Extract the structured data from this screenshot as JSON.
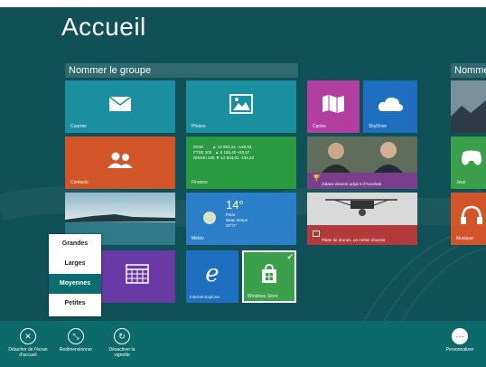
{
  "start": {
    "title": "Accueil"
  },
  "groups": [
    {
      "name": "Nommer le groupe"
    },
    {
      "name": "Nomme"
    }
  ],
  "tiles": {
    "mail": {
      "label": "Courrier"
    },
    "photos": {
      "label": "Photos"
    },
    "contacts": {
      "label": "Contacts"
    },
    "finance": {
      "label": "Finance",
      "rows": [
        "DOW        ▲ 14 993,14 +149,83",
        "FTSE 100   ▲ 6 165,40 +63,57",
        "NIKKEI 225 ▼ 12 834,01 -135,33"
      ]
    },
    "desktop": {
      "label": ""
    },
    "weather": {
      "label": "Météo",
      "temp": "14°",
      "city": "Paris",
      "cond": "Beau temps",
      "range": "20°/7°"
    },
    "ie": {
      "label": "Internet Explorer"
    },
    "store": {
      "label": "Windows Store"
    },
    "cartes": {
      "label": "Cartes"
    },
    "skydrive": {
      "label": "SkyDrive"
    },
    "news1": {
      "text": "Zidane devient adjoint d'Ancelotti"
    },
    "news2": {
      "text": "Pilote de drones, un métier d'avenir"
    },
    "jeux": {
      "label": "Jeux"
    },
    "musique": {
      "label": "Musique"
    }
  },
  "menu": {
    "items": [
      "Grandes",
      "Larges",
      "Moyennes",
      "Petites"
    ],
    "selected": "Moyennes"
  },
  "appbar": {
    "unpin": "Détacher de l'écran d'accueil",
    "resize": "Redimensionner",
    "live": "Désactiver la vignette",
    "customize": "Personnaliser"
  },
  "colors": {
    "background": "#0f5157",
    "mail": "#1a8fa0",
    "contacts": "#d2552a",
    "finance": "#2a9a3e",
    "weather": "#2a7fc8",
    "store": "#3aa04a",
    "cartes": "#b23ea0",
    "skydrive": "#1e6fc0",
    "games": "#3aa04a",
    "music": "#d2552a",
    "appbar": "#0c6a6a"
  }
}
